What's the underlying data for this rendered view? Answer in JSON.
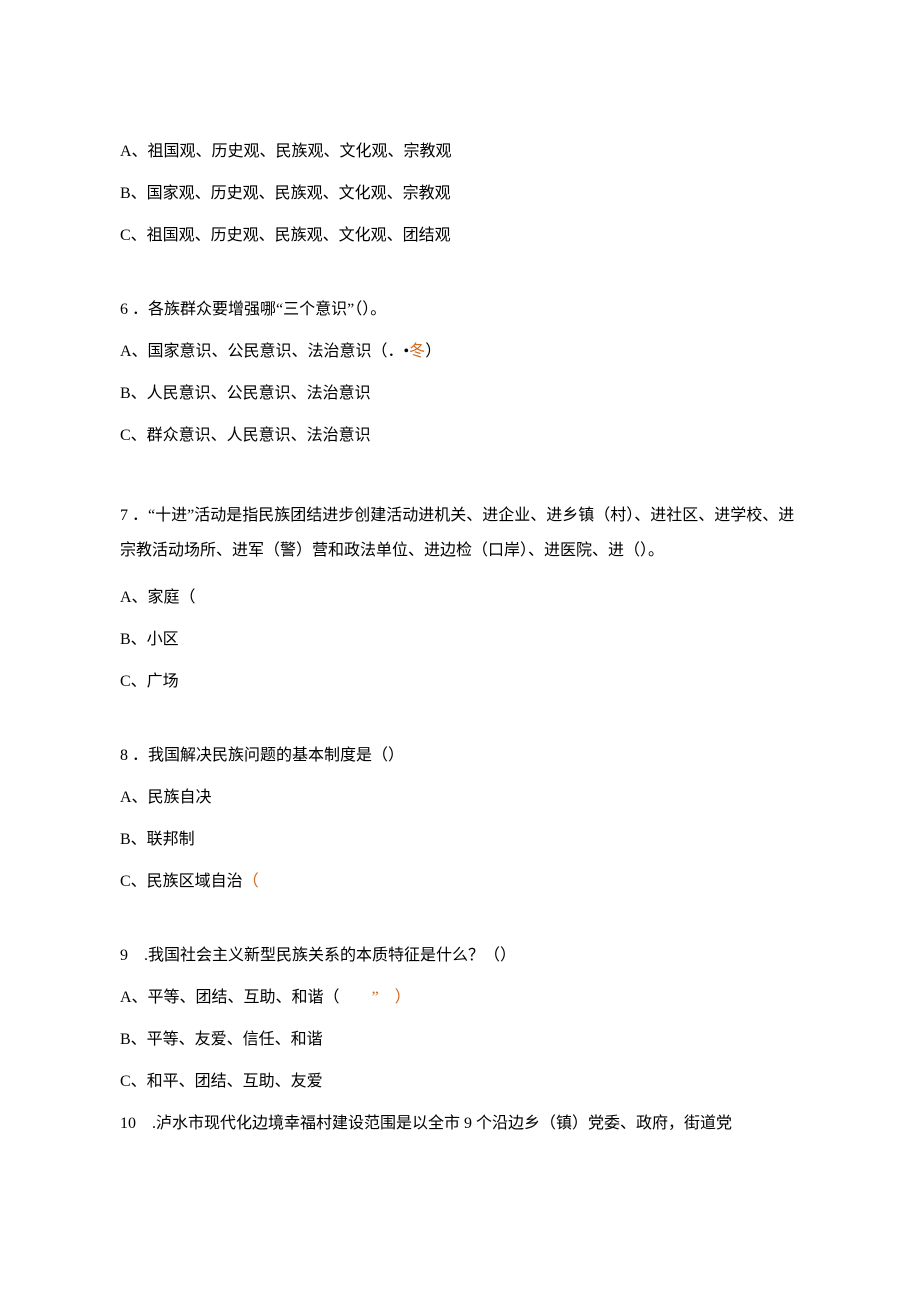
{
  "q5": {
    "optA": "A、祖国观、历史观、民族观、文化观、宗教观",
    "optB": "B、国家观、历史观、民族观、文化观、宗教观",
    "optC": "C、祖国观、历史观、民族观、文化观、团结观"
  },
  "q6": {
    "stem": "6 ．各族群众要增强哪“三个意识”（）。",
    "optA_prefix": "A、国家意识、公民意识、法治意识（．•",
    "optA_annot": "冬",
    "optA_suffix": "）",
    "optB": "B、人民意识、公民意识、法治意识",
    "optC": "C、群众意识、人民意识、法治意识"
  },
  "q7": {
    "stem": "7 ．“十进”活动是指民族团结进步创建活动进机关、进企业、进乡镇（村）、进社区、进学校、进宗教活动场所、进军（警）营和政法单位、进边检（口岸）、进医院、进（）。",
    "optA": "A、家庭（",
    "optB": "B、小区",
    "optC": "C、广场"
  },
  "q8": {
    "stem": "8 ．我国解决民族问题的基本制度是（）",
    "optA": "A、民族自决",
    "optB": "B、联邦制",
    "optC_prefix": "C、民族区域自治",
    "optC_annot": "（"
  },
  "q9": {
    "stem": "9　.我国社会主义新型民族关系的本质特征是什么？（）",
    "optA_prefix": "A、平等、团结、互助、和谐（　　",
    "optA_annot": "”　）",
    "optB": "B、平等、友爱、信任、和谐",
    "optC": "C、和平、团结、互助、友爱"
  },
  "q10": {
    "stem": "10　.泸水市现代化边境幸福村建设范围是以全市 9 个沿边乡（镇）党委、政府，街道党"
  }
}
